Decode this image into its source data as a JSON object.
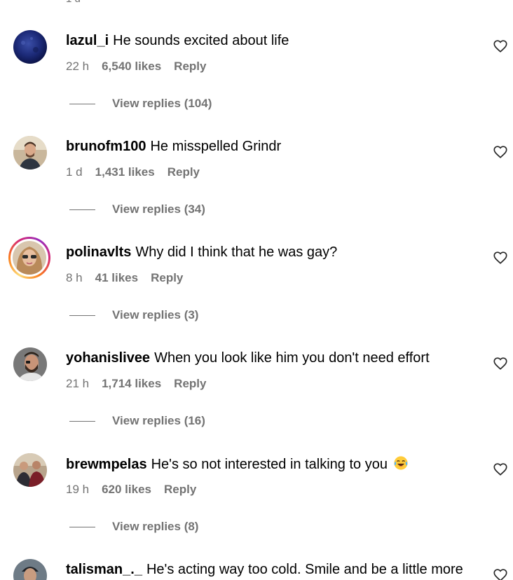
{
  "top_partial": "1 d",
  "comments": [
    {
      "username": "lazul_i",
      "text": "He sounds excited about life",
      "time": "22 h",
      "likes": "6,540 likes",
      "reply": "Reply",
      "view_replies": "View replies (104)",
      "avatar_icon": "blue-texture-avatar"
    },
    {
      "username": "brunofm100",
      "text": "He misspelled Grindr",
      "time": "1 d",
      "likes": "1,431 likes",
      "reply": "Reply",
      "view_replies": "View replies (34)",
      "avatar_icon": "man-portrait-avatar"
    },
    {
      "username": "polinavlts",
      "text": "Why did I think that he was gay?",
      "time": "8 h",
      "likes": "41 likes",
      "reply": "Reply",
      "view_replies": "View replies (3)",
      "avatar_icon": "woman-sunglasses-avatar"
    },
    {
      "username": "yohanislivee",
      "text": "When you look like him you don't need effort",
      "time": "21 h",
      "likes": "1,714 likes",
      "reply": "Reply",
      "view_replies": "View replies (16)",
      "avatar_icon": "bearded-man-avatar"
    },
    {
      "username": "brewmpelas",
      "text": "He's so not interested in talking to you",
      "time": "19 h",
      "likes": "620 likes",
      "reply": "Reply",
      "view_replies": "View replies (8)",
      "avatar_icon": "group-photo-avatar",
      "emoji": "laughing-tears-emoji"
    },
    {
      "username": "talisman_._",
      "text": "He's acting way too cold. Smile and be a little more",
      "avatar_icon": "man-cap-avatar"
    }
  ],
  "colors": {
    "meta_gray": "#737373",
    "story_ring": "#d62976"
  }
}
